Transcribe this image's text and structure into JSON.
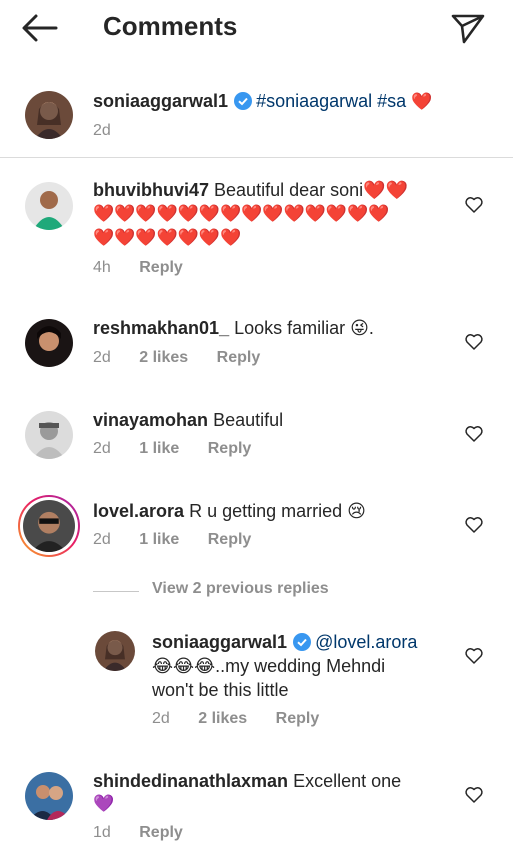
{
  "header": {
    "title": "Comments",
    "back_icon": "arrow-left-icon",
    "share_icon": "paper-plane-icon"
  },
  "caption": {
    "username": "soniaaggarwal1",
    "text": "#soniaagarwal #sa",
    "emoji": "❤️",
    "time": "2d"
  },
  "comments": [
    {
      "username": "bhuvibhuvi47",
      "text_line1": "Beautiful dear soni❤️❤️",
      "text_line2": "❤️❤️❤️❤️❤️❤️❤️❤️❤️❤️❤️❤️❤️❤️",
      "text_line3": "❤️❤️❤️❤️❤️❤️❤️",
      "time": "4h",
      "reply": "Reply"
    },
    {
      "username": "reshmakhan01_",
      "text": "Looks familiar 😜.",
      "time": "2d",
      "likes": "2 likes",
      "reply": "Reply"
    },
    {
      "username": "vinayamohan",
      "text": "Beautiful",
      "time": "2d",
      "likes": "1 like",
      "reply": "Reply"
    },
    {
      "username": "lovel.arora",
      "text": "R u getting married 😢",
      "time": "2d",
      "likes": "1 like",
      "reply": "Reply"
    },
    {
      "username": "shindedinanathlaxman",
      "text": "Excellent one",
      "text_line2": "💜",
      "time": "1d",
      "reply": "Reply"
    }
  ],
  "view_replies": "View 2 previous replies",
  "reply": {
    "username": "soniaaggarwal1",
    "mention": "@lovel.arora",
    "text_line2": "😂😂😂..my wedding Mehndi",
    "text_line3": "won't be this little",
    "time": "2d",
    "likes": "2 likes",
    "reply": "Reply"
  },
  "colors": {
    "text": "#262626",
    "meta": "#8e8e8e",
    "link": "#00376b",
    "verified": "#3897f0",
    "divider": "#dbdbdb"
  }
}
